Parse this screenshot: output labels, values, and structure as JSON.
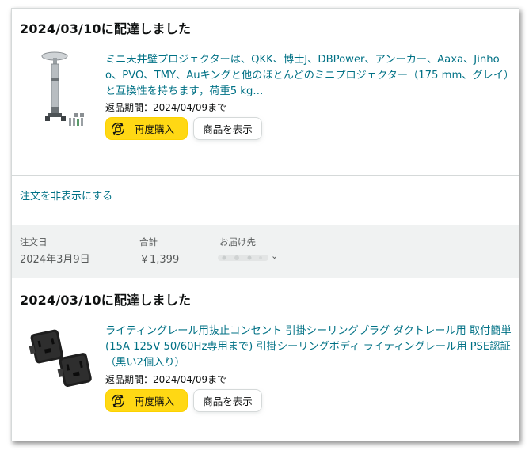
{
  "orders": [
    {
      "delivery_status": "2024/03/10に配達しました",
      "product_title": "ミニ天井壁プロジェクターは、QKK、博士J、DBPower、アンーカー、Aaxa、Jinhoo、PVO、TMY、Auキングと他のほとんどのミニプロジェクター（175 mm、グレイ）と互換性を持ちます，荷重5 kg…",
      "return_window": "返品期間：2024/04/09まで",
      "buy_again_label": "再度購入",
      "view_item_label": "商品を表示"
    },
    {
      "delivery_status": "2024/03/10に配達しました",
      "product_title": "ライティングレール用抜止コンセント 引掛シーリングプラグ ダクトレール用 取付簡単(15A 125V 50/60Hz専用まで) 引掛シーリングボディ ライティングレール用 PSE認証（黒い2個入り）",
      "return_window": "返品期間：2024/04/09まで",
      "buy_again_label": "再度購入",
      "view_item_label": "商品を表示"
    }
  ],
  "hide_order_link": "注文を非表示にする",
  "order_header": {
    "order_date_label": "注文日",
    "order_date": "2024年3月9日",
    "total_label": "合計",
    "total": "￥1,399",
    "ship_to_label": "お届け先"
  },
  "colors": {
    "link": "#007185",
    "buy_button": "#ffd814",
    "header_bg": "#f0f2f2",
    "text": "#0f1111"
  }
}
